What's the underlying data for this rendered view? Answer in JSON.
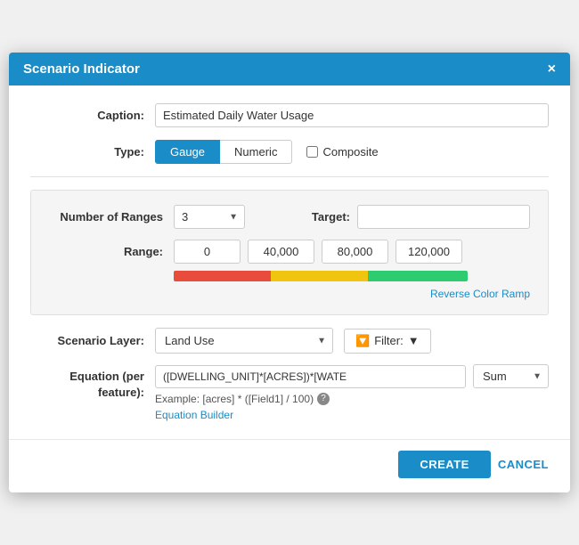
{
  "modal": {
    "title": "Scenario Indicator",
    "close_label": "×"
  },
  "form": {
    "caption_label": "Caption:",
    "caption_value": "Estimated Daily Water Usage",
    "type_label": "Type:",
    "type_gauge_label": "Gauge",
    "type_numeric_label": "Numeric",
    "composite_label": "Composite"
  },
  "ranges": {
    "num_ranges_label": "Number of Ranges",
    "num_ranges_value": "3",
    "target_label": "Target:",
    "target_value": "",
    "range_label": "Range:",
    "range_values": [
      "0",
      "40,000",
      "80,000",
      "120,000"
    ],
    "reverse_color_label": "Reverse Color Ramp"
  },
  "scenario": {
    "layer_label": "Scenario Layer:",
    "layer_value": "Land Use",
    "filter_label": "Filter:",
    "equation_label": "Equation (per feature):",
    "equation_value": "([DWELLING_UNIT]*[ACRES])*[WATE",
    "sum_label": "Sum",
    "example_text": "Example: [acres] * ([Field1] / 100)",
    "equation_builder_label": "Equation Builder"
  },
  "footer": {
    "create_label": "CREATE",
    "cancel_label": "CANCEL"
  },
  "icons": {
    "close": "×",
    "dropdown_arrow": "▼",
    "filter": "⊟",
    "help": "?"
  }
}
